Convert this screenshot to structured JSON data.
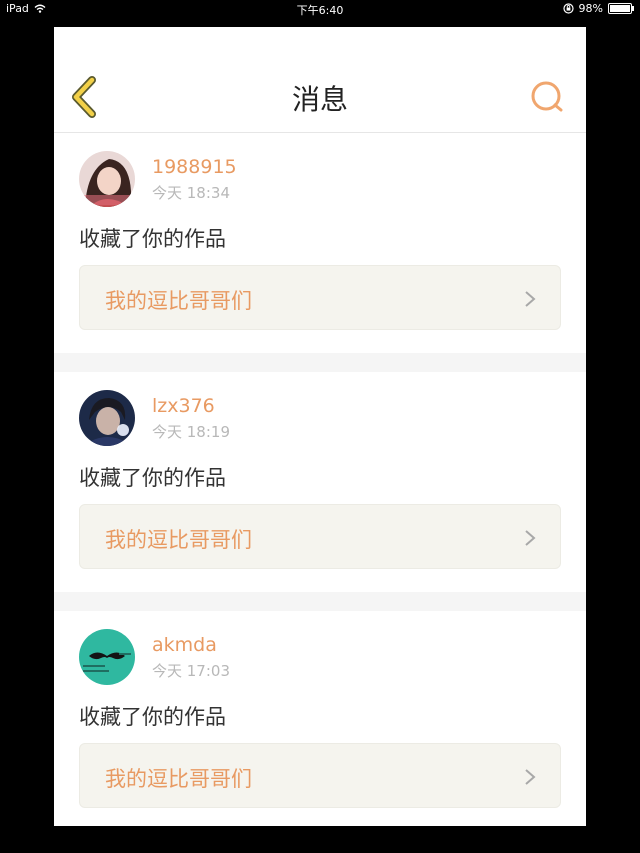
{
  "status_bar": {
    "device": "iPad",
    "time": "下午6:40",
    "battery": "98%",
    "battery_level": 0.98
  },
  "nav": {
    "title": "消息"
  },
  "messages": [
    {
      "username": "1988915",
      "time": "今天 18:34",
      "action": "收藏了你的作品",
      "work_title": "我的逗比哥哥们"
    },
    {
      "username": "lzx376",
      "time": "今天 18:19",
      "action": "收藏了你的作品",
      "work_title": "我的逗比哥哥们"
    },
    {
      "username": "akmda",
      "time": "今天 17:03",
      "action": "收藏了你的作品",
      "work_title": "我的逗比哥哥们"
    }
  ],
  "colors": {
    "accent": "#e89a62",
    "back_icon": "#f2d048",
    "teal_avatar": "#2fb8a0"
  }
}
